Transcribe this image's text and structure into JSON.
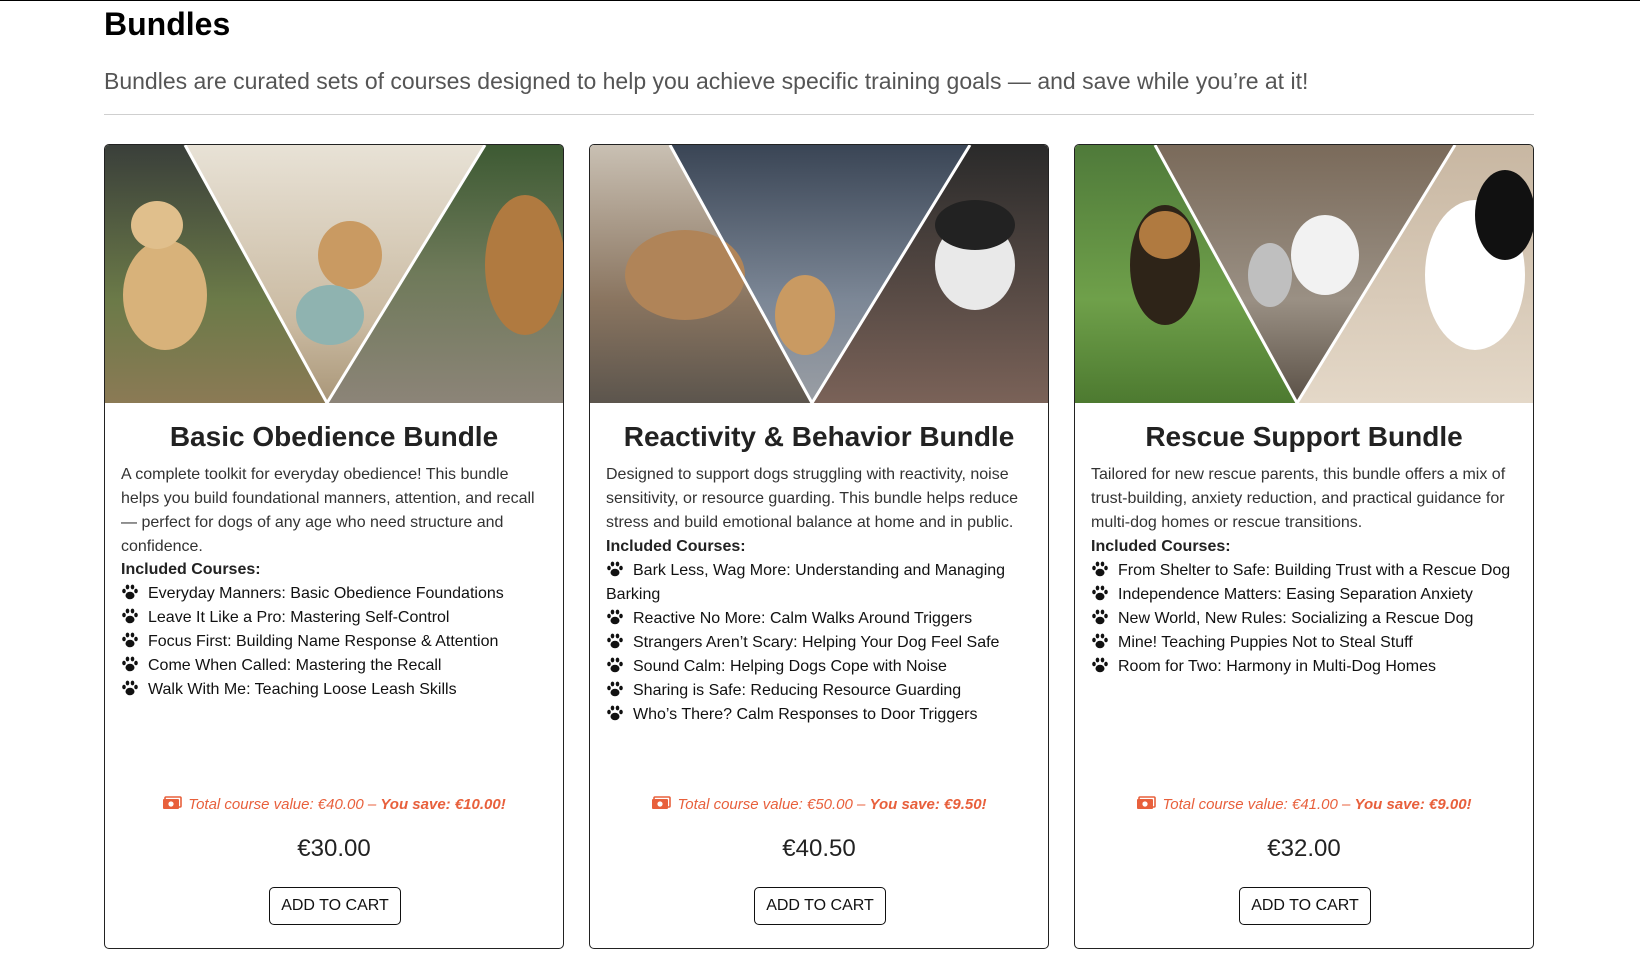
{
  "page": {
    "title": "Bundles",
    "subtitle": "Bundles are curated sets of courses designed to help you achieve specific training goals — and save while you’re at it!"
  },
  "accent_color": "#e8603c",
  "bundles": [
    {
      "title": "Basic Obedience Bundle",
      "description": "A complete toolkit for everyday obedience! This bundle helps you build foundational manners, attention, and recall — perfect for dogs of any age who need structure and confidence.",
      "courses_heading": "Included Courses:",
      "courses": [
        "Everyday Manners: Basic Obedience Foundations",
        "Leave It Like a Pro: Mastering Self-Control",
        "Focus First: Building Name Response & Attention",
        "Come When Called: Mastering the Recall",
        "Walk With Me: Teaching Loose Leash Skills"
      ],
      "savings_value": "Total course value: €40.00 – ",
      "savings_amount": "You save: €10.00!",
      "price": "€30.00",
      "cart_label": "ADD TO CART"
    },
    {
      "title": "Reactivity & Behavior Bundle",
      "description": "Designed to support dogs struggling with reactivity, noise sensitivity, or resource guarding. This bundle helps reduce stress and build emotional balance at home and in public.",
      "courses_heading": "Included Courses:",
      "courses": [
        "Bark Less, Wag More: Understanding and Managing Barking",
        "Reactive No More: Calm Walks Around Triggers",
        "Strangers Aren’t Scary: Helping Your Dog Feel Safe",
        "Sound Calm: Helping Dogs Cope with Noise",
        "Sharing is Safe: Reducing Resource Guarding",
        "Who’s There? Calm Responses to Door Triggers"
      ],
      "savings_value": "Total course value: €50.00 – ",
      "savings_amount": "You save: €9.50!",
      "price": "€40.50",
      "cart_label": "ADD TO CART"
    },
    {
      "title": "Rescue Support Bundle",
      "description": "Tailored for new rescue parents, this bundle offers a mix of trust-building, anxiety reduction, and practical guidance for multi-dog homes or rescue transitions.",
      "courses_heading": "Included Courses:",
      "courses": [
        "From Shelter to Safe: Building Trust with a Rescue Dog",
        "Independence Matters: Easing Separation Anxiety",
        "New World, New Rules: Socializing a Rescue Dog",
        "Mine! Teaching Puppies Not to Steal Stuff",
        "Room for Two: Harmony in Multi-Dog Homes"
      ],
      "savings_value": "Total course value: €41.00 – ",
      "savings_amount": "You save: €9.00!",
      "price": "€32.00",
      "cart_label": "ADD TO CART"
    }
  ]
}
